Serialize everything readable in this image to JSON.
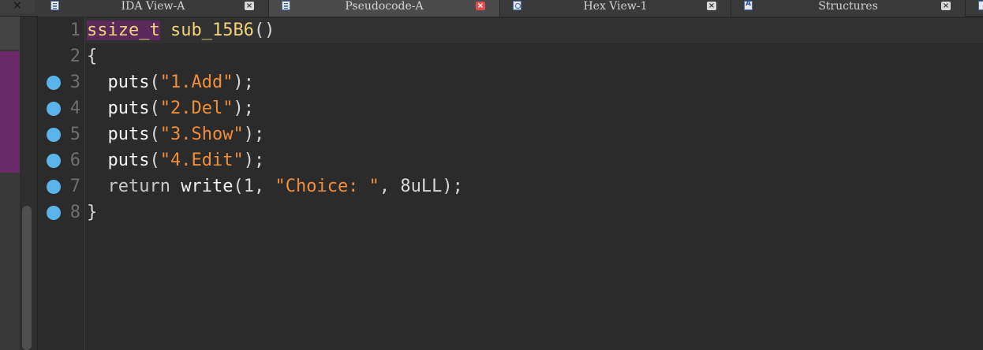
{
  "tabs": [
    {
      "label": "IDA View-A",
      "icon": "disassembly-icon",
      "active": false
    },
    {
      "label": "Pseudocode-A",
      "icon": "pseudocode-icon",
      "active": true
    },
    {
      "label": "Hex View-1",
      "icon": "hex-icon",
      "active": false
    },
    {
      "label": "Structures",
      "icon": "structures-icon",
      "active": false
    }
  ],
  "tab_close_glyph": "×",
  "corner_close_glyph": "✕",
  "editor": {
    "lines": [
      {
        "num": "1",
        "breakpoint": false,
        "tokens": {
          "type": "ssize_t",
          "sp": " ",
          "fn": "sub_15B6",
          "paren": "()"
        }
      },
      {
        "num": "2",
        "breakpoint": false,
        "tokens": {
          "brace": "{"
        }
      },
      {
        "num": "3",
        "breakpoint": true,
        "tokens": {
          "indent": "  ",
          "fn": "puts",
          "open": "(",
          "str": "\"1.Add\"",
          "close": ");"
        }
      },
      {
        "num": "4",
        "breakpoint": true,
        "tokens": {
          "indent": "  ",
          "fn": "puts",
          "open": "(",
          "str": "\"2.Del\"",
          "close": ");"
        }
      },
      {
        "num": "5",
        "breakpoint": true,
        "tokens": {
          "indent": "  ",
          "fn": "puts",
          "open": "(",
          "str": "\"3.Show\"",
          "close": ");"
        }
      },
      {
        "num": "6",
        "breakpoint": true,
        "tokens": {
          "indent": "  ",
          "fn": "puts",
          "open": "(",
          "str": "\"4.Edit\"",
          "close": ");"
        }
      },
      {
        "num": "7",
        "breakpoint": true,
        "tokens": {
          "indent": "  ",
          "kw": "return",
          "sp": " ",
          "fn": "write",
          "open": "(",
          "arg1": "1",
          "comma1": ", ",
          "str": "\"Choice: \"",
          "comma2": ", ",
          "arg3": "8uLL",
          "close": ");"
        }
      },
      {
        "num": "8",
        "breakpoint": true,
        "tokens": {
          "brace": "}"
        }
      }
    ]
  },
  "colors": {
    "background": "#2b2b2b",
    "breakpoint": "#5ab4ea",
    "string": "#f18e3a",
    "identifier": "#f0d37c",
    "highlight": "#5b2a5b",
    "active_tab_close": "#e04f4f"
  }
}
